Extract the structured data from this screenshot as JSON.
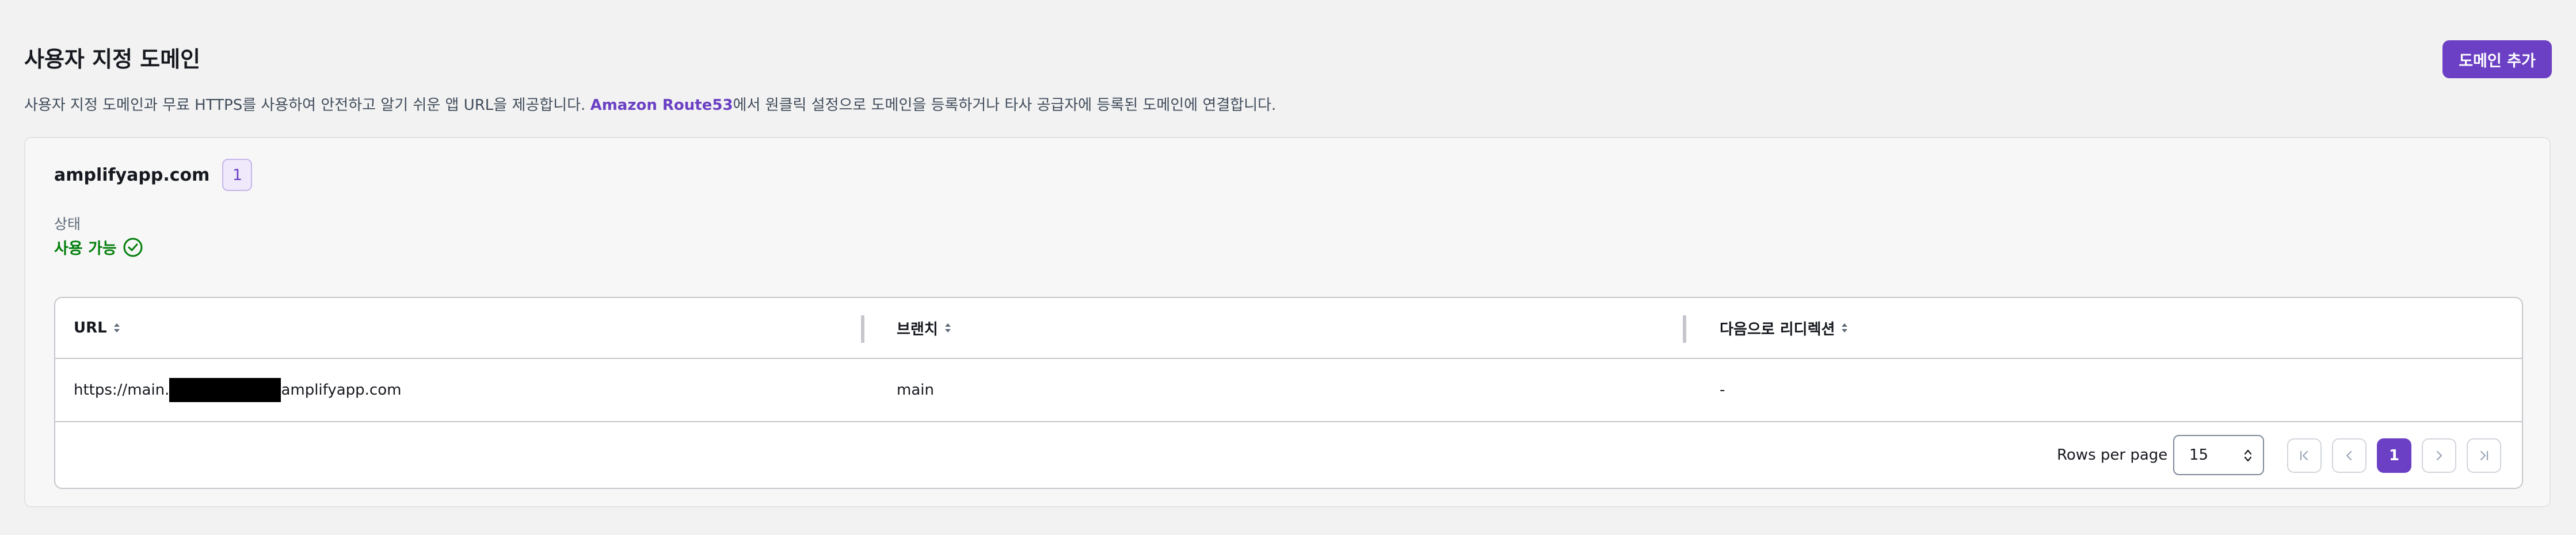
{
  "header": {
    "title": "사용자 지정 도메인",
    "add_button": "도메인 추가"
  },
  "description": {
    "before": "사용자 지정 도메인과 무료 HTTPS를 사용하여 안전하고 알기 쉬운 앱 URL을 제공합니다. ",
    "link": "Amazon Route53",
    "after": "에서 원클릭 설정으로 도메인을 등록하거나 타사 공급자에 등록된 도메인에 연결합니다."
  },
  "domain": {
    "name": "amplifyapp.com",
    "count": "1",
    "status_label": "상태",
    "status_value": "사용 가능",
    "status_color": "#037f0c"
  },
  "table": {
    "columns": [
      "URL",
      "브랜치",
      "다음으로 리디렉션"
    ],
    "rows": [
      {
        "url_prefix": "https://main.",
        "url_suffix": "amplifyapp.com",
        "branch": "main",
        "redirect": "-"
      }
    ]
  },
  "pagination": {
    "rows_per_page_label": "Rows per page",
    "rows_per_page_value": "15",
    "current_page": "1"
  },
  "colors": {
    "accent": "#6b40c4",
    "success": "#037f0c"
  },
  "icons": [
    "sort-icon",
    "check-circle-icon",
    "first-page-icon",
    "prev-page-icon",
    "next-page-icon",
    "last-page-icon",
    "select-caret-icon"
  ]
}
